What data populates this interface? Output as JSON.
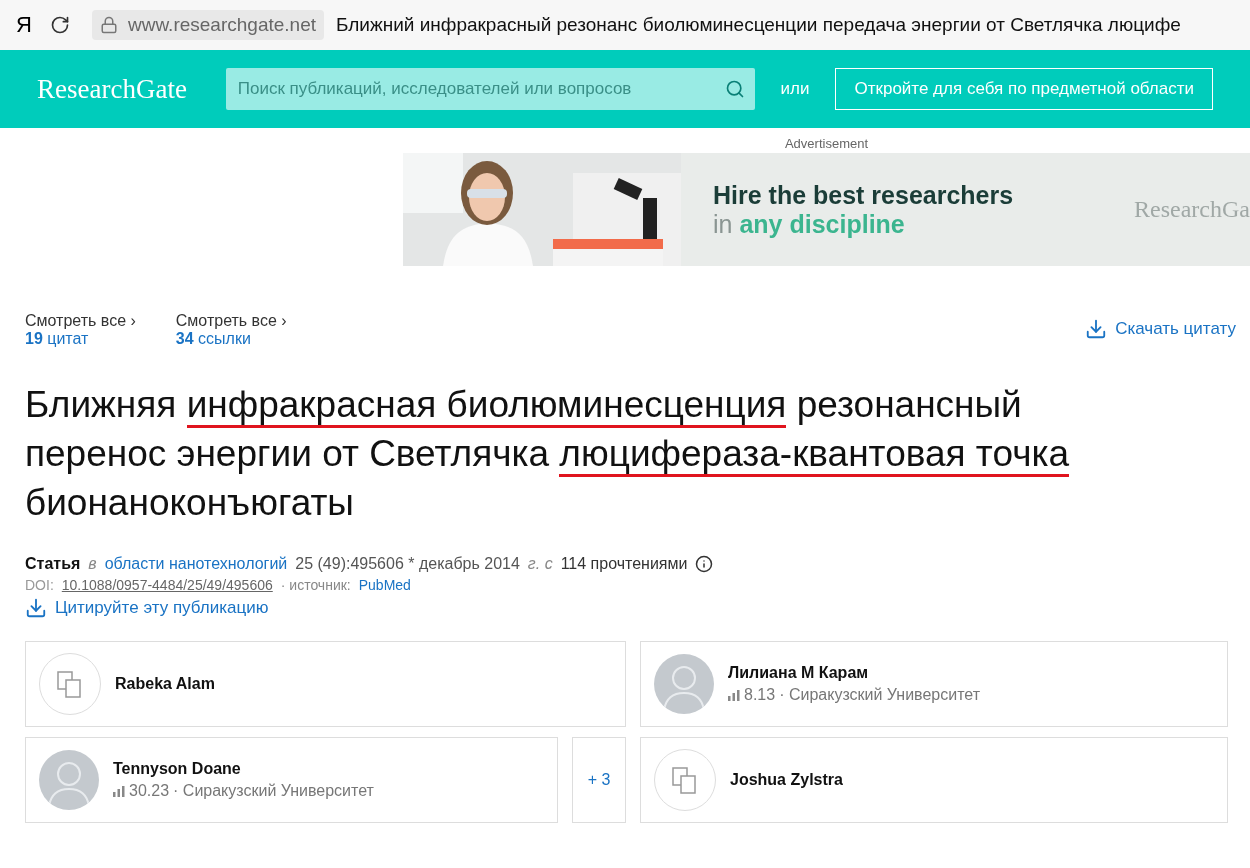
{
  "browser": {
    "logo": "Я",
    "url": "www.researchgate.net",
    "tab_title": "Ближний инфракрасный резонанс биолюминесценции передача энергии от Светлячка люцифе"
  },
  "header": {
    "logo": "ResearchGate",
    "search_placeholder": "Поиск публикаций, исследователей или вопросов",
    "or_text": "или",
    "discover_button": "Откройте для себя по предметной области"
  },
  "ad": {
    "label": "Advertisement",
    "headline": "Hire the best researchers",
    "sub_prefix": "in",
    "sub_highlight": "any discipline",
    "brand": "ResearchGa"
  },
  "stats": [
    {
      "caption": "Смотреть все ›",
      "count": "19",
      "unit": "цитат"
    },
    {
      "caption": "Смотреть все ›",
      "count": "34",
      "unit": "ссылки"
    }
  ],
  "download_citation": "Скачать цитату",
  "title": [
    {
      "text": "Ближняя ",
      "underlined": false
    },
    {
      "text": "инфракрасная биолюминесценция",
      "underlined": true
    },
    {
      "text": " резонансный перенос энергии от Светлячка ",
      "underlined": false
    },
    {
      "text": "люцифераза-квантовая точка",
      "underlined": true
    },
    {
      "text": " бионаноконъюгаты",
      "underlined": false
    }
  ],
  "meta": {
    "type": "Статья",
    "in": "в",
    "journal": "области нанотехнологий",
    "issue": "25 (49):495606 * декабрь 2014",
    "year_suffix": "г. с",
    "reads": "114 прочтениями",
    "doi_label": "DOI:",
    "doi": "10.1088/0957-4484/25/49/495606",
    "source_label": "· источник:",
    "source": "PubMed",
    "cite": "Цитируйте эту публикацию"
  },
  "authors": [
    {
      "name": "Rabeka Alam",
      "kind": "placeholder"
    },
    {
      "name": "Лилиана М Карам",
      "kind": "person",
      "score": "8.13",
      "affiliation": "· Сиракузский Университет"
    },
    {
      "name": "Tennyson Doane",
      "kind": "person",
      "score": "30.23",
      "affiliation": "· Сиракузский Университет"
    },
    {
      "name": "Joshua Zylstra",
      "kind": "placeholder"
    }
  ],
  "more_authors": "+ 3"
}
